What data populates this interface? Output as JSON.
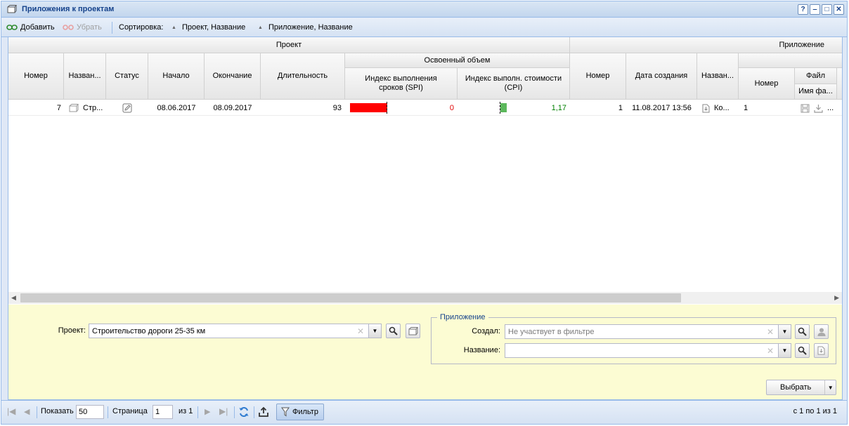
{
  "window": {
    "title": "Приложения к проектам",
    "buttons": [
      "?",
      "‒",
      "□",
      "✕"
    ]
  },
  "toolbar": {
    "add_label": "Добавить",
    "remove_label": "Убрать",
    "sort_label": "Сортировка:",
    "sort1": "Проект, Название",
    "sort2": "Приложение, Название"
  },
  "grid": {
    "group_project": "Проект",
    "group_app": "Приложение",
    "group_ev": "Освоенный объем",
    "group_file": "Файл",
    "columns": {
      "number": "Номер",
      "name": "Назван...",
      "status": "Статус",
      "start": "Начало",
      "end": "Окончание",
      "duration": "Длительность",
      "spi": "Индекс выполнения сроков (SPI)",
      "cpi": "Индекс выполн. стоимости (CPI)",
      "app_number": "Номер",
      "created": "Дата создания",
      "app_name": "Назван...",
      "file_number": "Номер",
      "file_name": "Имя фа..."
    },
    "row": {
      "number": "7",
      "name": "Стр...",
      "start": "08.06.2017",
      "end": "08.09.2017",
      "duration": "93",
      "spi": "0",
      "cpi": "1,17",
      "app_number": "1",
      "created": "11.08.2017 13:56",
      "app_name": "Ко...",
      "file_number": "1",
      "file_more": "..."
    },
    "colors": {
      "spi_bar": "#ff0000",
      "cpi_bar": "#5cb85c",
      "spi_text": "#e00000",
      "cpi_text": "#008000"
    }
  },
  "filter": {
    "project_label": "Проект:",
    "project_value": "Строительство дороги 25-35 км",
    "app_legend": "Приложение",
    "created_label": "Создал:",
    "created_placeholder": "Не участвует в фильтре",
    "name_label": "Название:",
    "name_value": "",
    "select_button": "Выбрать"
  },
  "pager": {
    "show_label": "Показать",
    "page_size": "50",
    "page_label": "Страница",
    "page_value": "1",
    "of_label": "из 1",
    "filter_button": "Фильтр",
    "summary": "с 1 по 1 из 1"
  }
}
